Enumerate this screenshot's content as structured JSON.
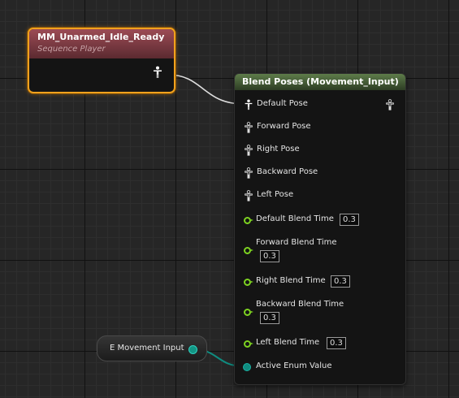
{
  "sequence_player": {
    "title": "MM_Unarmed_Idle_Ready",
    "subtitle": "Sequence Player",
    "header_color": "#9c4b55",
    "selected_border_color": "#f0a11e",
    "output_icon": "pose-figure-icon"
  },
  "blend_node": {
    "title": "Blend Poses (Movement_Input)",
    "header_color": "#5e7c4a",
    "output_icon": "pose-figure-icon",
    "pose_pins": [
      {
        "label": "Default Pose",
        "connected": true
      },
      {
        "label": "Forward Pose",
        "connected": false
      },
      {
        "label": "Right Pose",
        "connected": false
      },
      {
        "label": "Backward Pose",
        "connected": false
      },
      {
        "label": "Left Pose",
        "connected": false
      }
    ],
    "blend_time_pins": [
      {
        "label": "Default Blend Time",
        "value": "0.3"
      },
      {
        "label": "Forward Blend Time",
        "value": "0.3"
      },
      {
        "label": "Right Blend Time",
        "value": "0.3"
      },
      {
        "label": "Backward Blend Time",
        "value": "0.3"
      },
      {
        "label": "Left Blend Time",
        "value": "0.3"
      }
    ],
    "enum_pin": {
      "label": "Active Enum Value",
      "color": "#0f8c80"
    }
  },
  "enum_variable": {
    "label": "E Movement Input",
    "pin_color": "#129584"
  },
  "colors": {
    "float_pin": "#7ed321",
    "pose_wire": "#dedede",
    "enum_wire": "#0f8c80",
    "grid_background": "#262626"
  }
}
